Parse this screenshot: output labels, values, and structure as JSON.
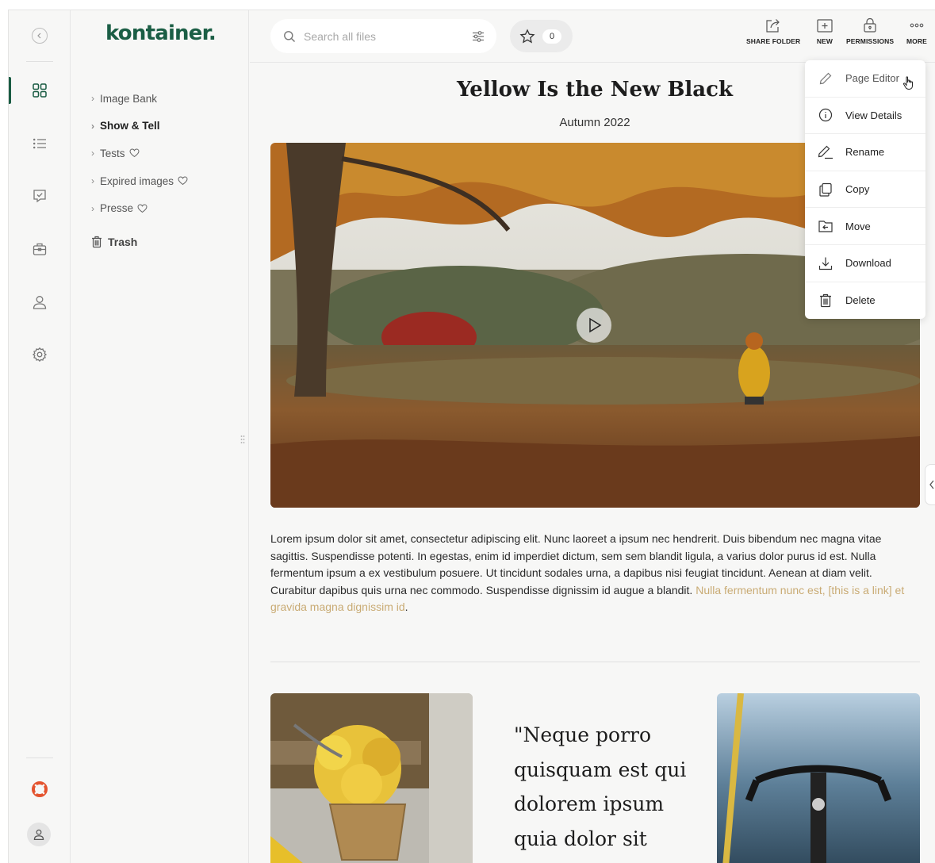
{
  "app": {
    "logo": "kontainer."
  },
  "rail": {
    "items": [
      {
        "icon": "grid-icon",
        "active": true
      },
      {
        "icon": "list-icon"
      },
      {
        "icon": "chat-check-icon"
      },
      {
        "icon": "briefcase-icon"
      },
      {
        "icon": "user-icon"
      },
      {
        "icon": "gear-icon"
      }
    ],
    "help_icon": "lifebuoy-icon",
    "avatar_icon": "user-avatar-icon",
    "accent": "#1a5c43",
    "help_color": "#e4532e"
  },
  "sidebar": {
    "folders": [
      {
        "label": "Image Bank",
        "favorite": false
      },
      {
        "label": "Show & Tell",
        "favorite": false,
        "selected": true
      },
      {
        "label": "Tests",
        "favorite": true
      },
      {
        "label": "Expired images",
        "favorite": true
      },
      {
        "label": "Presse",
        "favorite": true
      }
    ],
    "trash_label": "Trash"
  },
  "topbar": {
    "search_placeholder": "Search all files",
    "favorites_count": "0",
    "actions": {
      "share": "SHARE FOLDER",
      "new": "NEW",
      "permissions": "PERMISSIONS",
      "more": "MORE"
    }
  },
  "content": {
    "title": "Yellow Is the New Black",
    "subtitle": "Autumn 2022",
    "body": "Lorem ipsum dolor sit amet, consectetur adipiscing elit. Nunc laoreet a ipsum nec hendrerit. Duis bibendum nec magna vitae sagittis. Suspendisse potenti. In egestas, enim id imperdiet dictum, sem sem blandit ligula, a varius dolor purus id est. Nulla fermentum ipsum a ex vestibulum posuere. Ut tincidunt sodales urna, a dapibus nisi feugiat tincidunt. Aenean at diam velit. Curabitur dapibus quis urna nec commodo. Suspendisse dignissim id augue a blandit. ",
    "body_link": "Nulla fermentum nunc est, [this is a link] et gravida magna dignissim id",
    "body_end": ".",
    "quote": "\"Neque porro quisquam est qui dolorem ipsum quia dolor sit amet",
    "link_color": "#c9ab74"
  },
  "more_menu": {
    "items": [
      {
        "label": "Page Editor",
        "icon": "pencil-icon"
      },
      {
        "label": "View Details",
        "icon": "info-icon"
      },
      {
        "label": "Rename",
        "icon": "rename-icon"
      },
      {
        "label": "Copy",
        "icon": "copy-icon"
      },
      {
        "label": "Move",
        "icon": "move-folder-icon"
      },
      {
        "label": "Download",
        "icon": "download-icon"
      },
      {
        "label": "Delete",
        "icon": "trash-icon"
      }
    ]
  }
}
